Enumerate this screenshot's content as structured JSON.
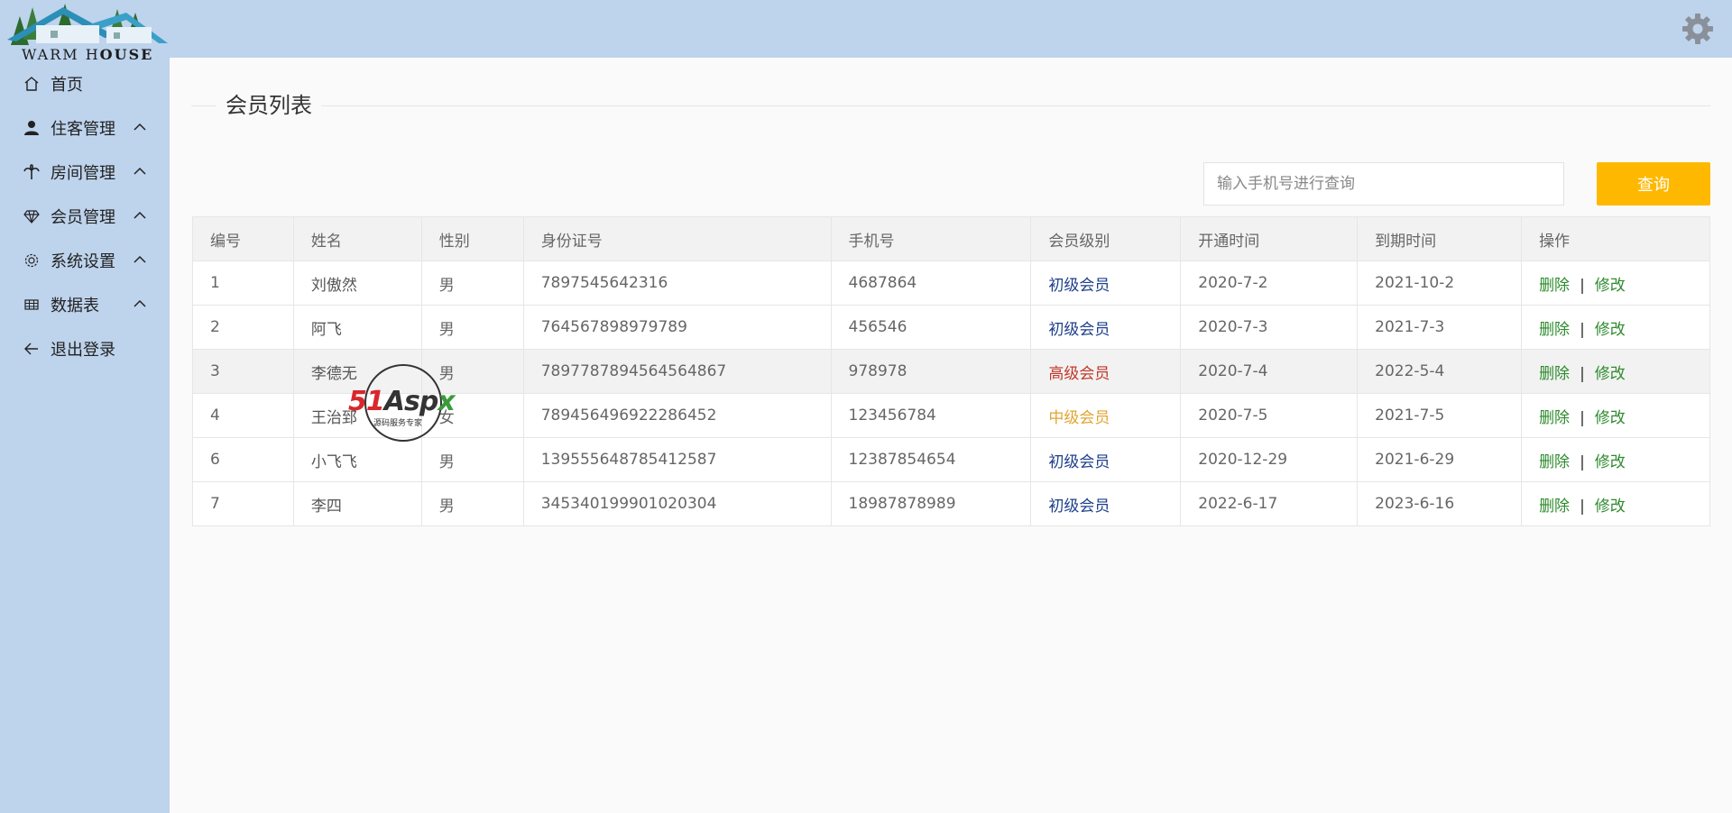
{
  "brand": {
    "name_prefix": "WARM H",
    "name_bold": "OUSE"
  },
  "sidebar": {
    "items": [
      {
        "label": "首页",
        "icon": "home-icon",
        "expandable": false
      },
      {
        "label": "住客管理",
        "icon": "user-icon",
        "expandable": true
      },
      {
        "label": "房间管理",
        "icon": "palm-icon",
        "expandable": true
      },
      {
        "label": "会员管理",
        "icon": "diamond-icon",
        "expandable": true
      },
      {
        "label": "系统设置",
        "icon": "settings-icon",
        "expandable": true
      },
      {
        "label": "数据表",
        "icon": "table-icon",
        "expandable": true
      },
      {
        "label": "退出登录",
        "icon": "arrow-left-icon",
        "expandable": false
      }
    ]
  },
  "header": {
    "settings_icon": "gear-icon"
  },
  "main": {
    "title": "会员列表",
    "search": {
      "placeholder": "输入手机号进行查询",
      "value": "",
      "button_label": "查询"
    },
    "table": {
      "columns": [
        "编号",
        "姓名",
        "性别",
        "身份证号",
        "手机号",
        "会员级别",
        "开通时间",
        "到期时间",
        "操作"
      ],
      "rows": [
        {
          "id": "1",
          "name": "刘傲然",
          "gender": "男",
          "id_card": "7897545642316",
          "phone": "4687864",
          "level": "初级会员",
          "level_type": "primary",
          "start": "2020-7-2",
          "end": "2021-10-2"
        },
        {
          "id": "2",
          "name": "阿飞",
          "gender": "男",
          "id_card": "764567898979789",
          "phone": "456546",
          "level": "初级会员",
          "level_type": "primary",
          "start": "2020-7-3",
          "end": "2021-7-3"
        },
        {
          "id": "3",
          "name": "李德无",
          "gender": "男",
          "id_card": "7897787894564564867",
          "phone": "978978",
          "level": "高级会员",
          "level_type": "high",
          "start": "2020-7-4",
          "end": "2022-5-4"
        },
        {
          "id": "4",
          "name": "王治郅",
          "gender": "女",
          "id_card": "78945649692228645​2",
          "phone": "123456784",
          "level": "中级会员",
          "level_type": "mid",
          "start": "2020-7-5",
          "end": "2021-7-5"
        },
        {
          "id": "6",
          "name": "小飞飞",
          "gender": "男",
          "id_card": "139555648785412587",
          "phone": "12387854654",
          "level": "初级会员",
          "level_type": "primary",
          "start": "2020-12-29",
          "end": "2021-6-29"
        },
        {
          "id": "7",
          "name": "李四",
          "gender": "男",
          "id_card": "345340199901020304",
          "phone": "18987878989",
          "level": "初级会员",
          "level_type": "primary",
          "start": "2022-6-17",
          "end": "2023-6-16"
        }
      ],
      "actions": {
        "delete": "删除",
        "separator": "|",
        "edit": "修改"
      }
    }
  },
  "watermark": {
    "text_red": "51",
    "text_dark": "Asp",
    "text_green": "x",
    "subtitle": "源码服务专家"
  },
  "colors": {
    "sidebar_bg": "#bed3ec",
    "accent_button": "#ffb800",
    "action_link": "#2e8b2e",
    "level_primary": "#1e3f8c",
    "level_high": "#c0392b",
    "level_mid": "#e0a532"
  }
}
